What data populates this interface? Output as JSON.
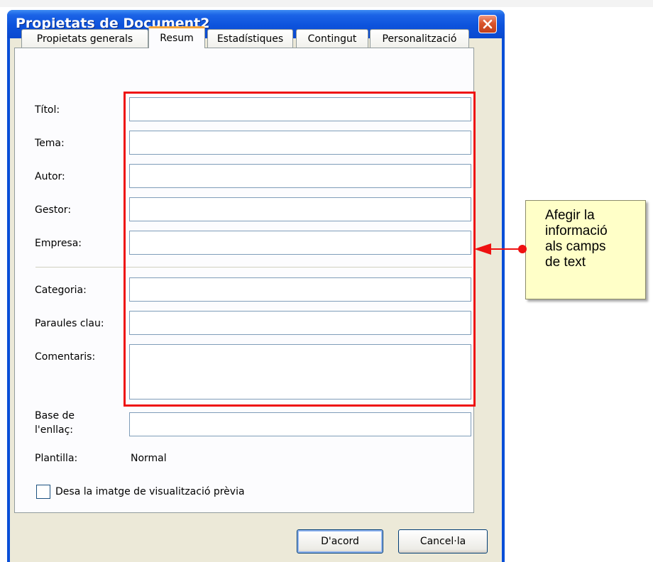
{
  "window": {
    "title": "Propietats de Document2"
  },
  "tabs": [
    {
      "label": "Propietats generals",
      "active": false
    },
    {
      "label": "Resum",
      "active": true
    },
    {
      "label": "Estadístiques",
      "active": false
    },
    {
      "label": "Contingut",
      "active": false
    },
    {
      "label": "Personalització",
      "active": false
    }
  ],
  "fields": [
    {
      "label": "Títol:",
      "value": ""
    },
    {
      "label": "Tema:",
      "value": ""
    },
    {
      "label": "Autor:",
      "value": ""
    },
    {
      "label": "Gestor:",
      "value": ""
    },
    {
      "label": "Empresa:",
      "value": ""
    },
    {
      "label": "Categoria:",
      "value": ""
    },
    {
      "label": "Paraules clau:",
      "value": ""
    },
    {
      "label": "Comentaris:",
      "value": ""
    },
    {
      "label_line1": "Base de",
      "label_line2": "l'enllaç:",
      "value": ""
    }
  ],
  "template": {
    "label": "Plantilla:",
    "value": "Normal"
  },
  "preview_checkbox": {
    "label": "Desa la imatge de visualització prèvia",
    "checked": false
  },
  "buttons": {
    "ok": "D'acord",
    "cancel": "Cancel·la"
  },
  "callout": {
    "lines": [
      "Afegir la",
      "informació",
      "als camps",
      "de text"
    ],
    "color": "#ffffc8"
  },
  "colors": {
    "titlebar": "#0d53dc",
    "highlight": "#ee1111",
    "tab_active_accent": "#f4a43a"
  },
  "icons": {
    "close": "close-icon"
  }
}
